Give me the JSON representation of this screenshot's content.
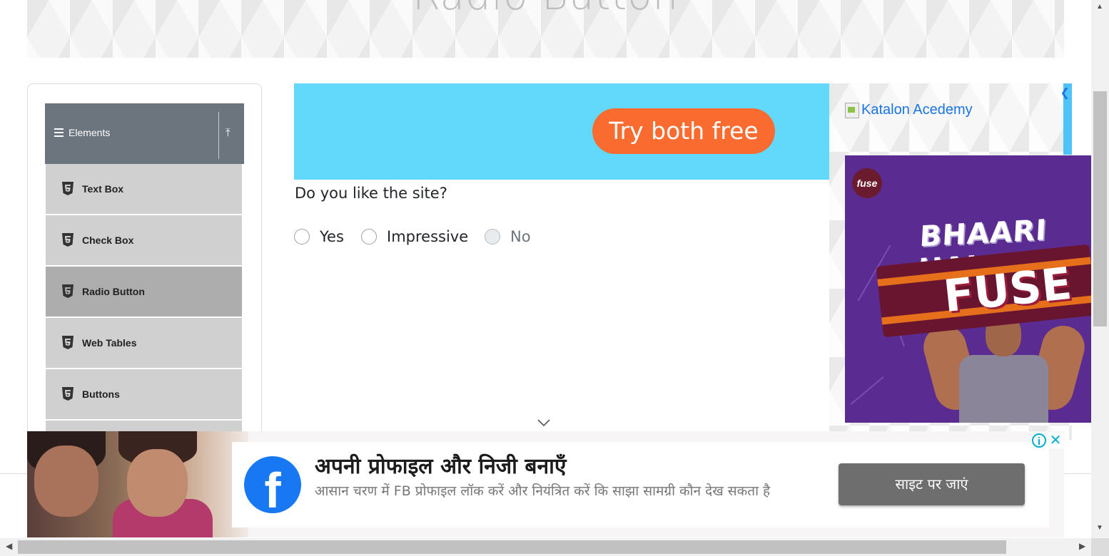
{
  "page": {
    "title": "Radio Button"
  },
  "sidebar": {
    "group_title": "Elements",
    "items": [
      {
        "label": "Text Box",
        "active": false
      },
      {
        "label": "Check Box",
        "active": false
      },
      {
        "label": "Radio Button",
        "active": true
      },
      {
        "label": "Web Tables",
        "active": false
      },
      {
        "label": "Buttons",
        "active": false
      }
    ]
  },
  "ad_top": {
    "cta_label": "Try both free",
    "bg_color": "#62d8fb",
    "cta_color": "#fa6b2f"
  },
  "main": {
    "question": "Do you like the site?",
    "options": [
      {
        "label": "Yes",
        "disabled": false,
        "checked": false
      },
      {
        "label": "Impressive",
        "disabled": false,
        "checked": false
      },
      {
        "label": "No",
        "disabled": true,
        "checked": false
      }
    ]
  },
  "ad_right": {
    "katalon_alt": "Katalon Acedemy",
    "fuse_logo": "fuse",
    "headline": "BHAARI HAI",
    "product": "FUSE"
  },
  "ad_bottom": {
    "fb_icon": "f",
    "title": "अपनी प्रोफाइल और निजी बनाएँ",
    "description": "आसान चरण में FB प्रोफाइल लॉक करें और नियंत्रित करें कि साझा सामग्री कौन देख सकता है",
    "button_label": "साइट पर जाएं",
    "adchoices_icon": "i",
    "close_icon": "✕",
    "brand_color": "#1877f2"
  },
  "icons": {
    "menu": "hamburger-icon",
    "collapse": "upload-icon",
    "item": "html5-icon",
    "scroll_down": "chevron-down-icon"
  }
}
